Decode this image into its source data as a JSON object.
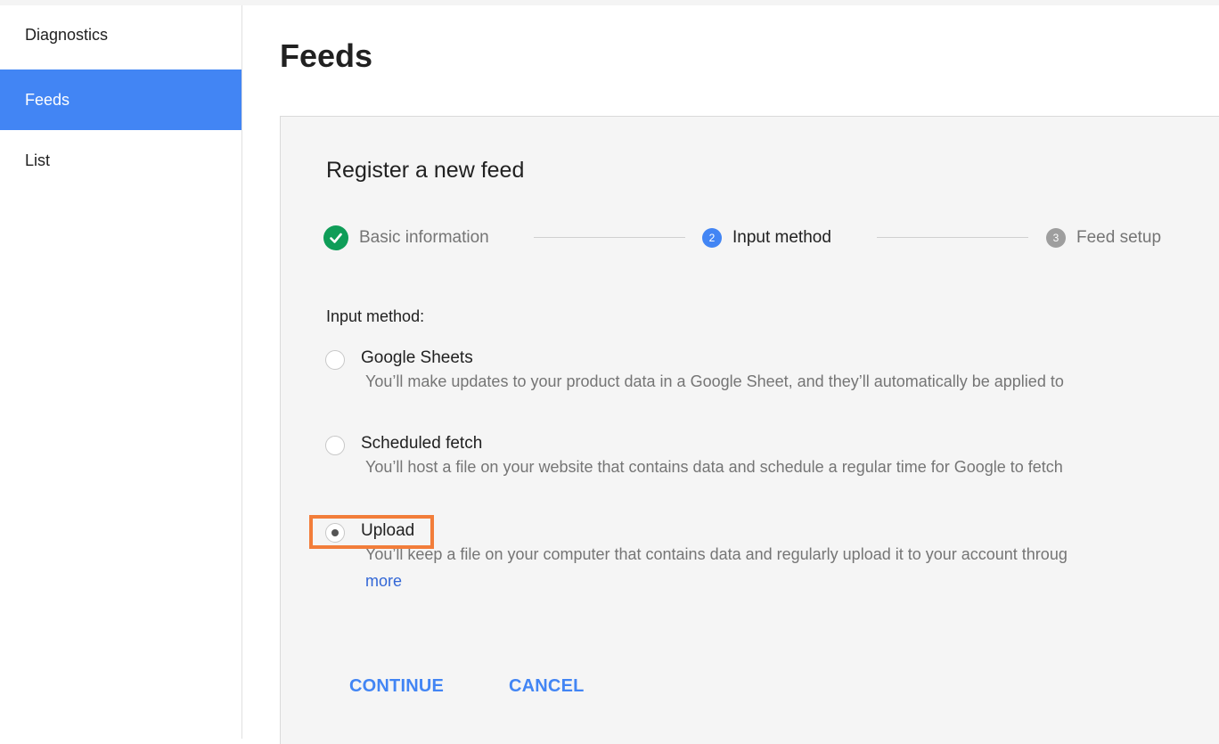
{
  "sidebar": {
    "items": [
      {
        "label": "Diagnostics",
        "active": false
      },
      {
        "label": "Feeds",
        "active": true
      },
      {
        "label": "List",
        "active": false
      }
    ]
  },
  "page": {
    "title": "Feeds"
  },
  "card": {
    "title": "Register a new feed",
    "steps": [
      {
        "number": "1",
        "label": "Basic information",
        "state": "completed",
        "icon": "check-icon"
      },
      {
        "number": "2",
        "label": "Input method",
        "state": "current"
      },
      {
        "number": "3",
        "label": "Feed setup",
        "state": "upcoming"
      }
    ],
    "section_label": "Input method:",
    "options": [
      {
        "title": "Google Sheets",
        "description": "You’ll make updates to your product data in a Google Sheet, and they’ll automatically be applied to",
        "selected": false
      },
      {
        "title": "Scheduled fetch",
        "description": "You’ll host a file on your website that contains data and schedule a regular time for Google to fetch",
        "selected": false
      },
      {
        "title": "Upload",
        "description": "You’ll keep a file on your computer that contains data and regularly upload it to your account throug",
        "more": "more",
        "selected": true
      }
    ],
    "buttons": {
      "continue": "CONTINUE",
      "cancel": "CANCEL"
    }
  },
  "colors": {
    "accent": "#4285f4",
    "step_done": "#0f9d58",
    "step_upcoming": "#9e9e9e",
    "highlight": "#f27d3a",
    "link": "#3367d6"
  }
}
